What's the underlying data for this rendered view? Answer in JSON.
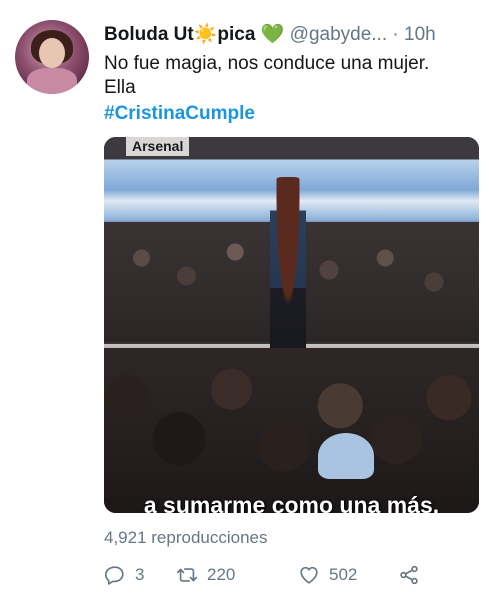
{
  "tweet": {
    "author_name": "Boluda Ut",
    "author_name_sun": "☀️",
    "author_name_end": "pica",
    "author_heart": "💚",
    "handle": "@gabyde...",
    "separator": "·",
    "time": "10h",
    "text_line1": "No fue magia, nos conduce una mujer.",
    "text_line2": "Ella",
    "hashtag": "#CristinaCumple",
    "media": {
      "channel_label": "Arsenal",
      "subtitle": "a sumarme como una más."
    },
    "views": "4,921 reproducciones",
    "actions": {
      "reply_count": "3",
      "retweet_count": "220",
      "like_count": "502"
    },
    "icons": [
      "reply-icon",
      "retweet-icon",
      "like-icon",
      "share-icon"
    ]
  }
}
